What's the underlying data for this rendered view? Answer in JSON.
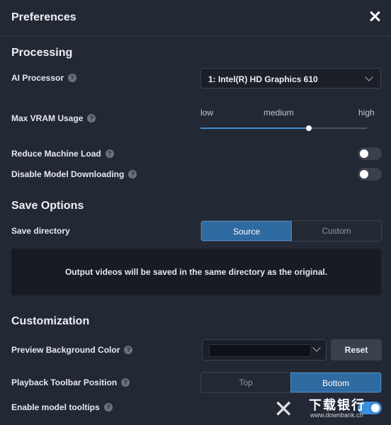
{
  "window": {
    "title": "Preferences"
  },
  "processing": {
    "heading": "Processing",
    "ai_processor": {
      "label": "AI Processor",
      "value": "1: Intel(R) HD Graphics 610"
    },
    "max_vram": {
      "label": "Max VRAM Usage",
      "low": "low",
      "medium": "medium",
      "high": "high",
      "level": 0.65
    },
    "reduce_machine_load": {
      "label": "Reduce Machine Load",
      "enabled": false
    },
    "disable_model_downloading": {
      "label": "Disable Model Downloading",
      "enabled": false
    }
  },
  "save_options": {
    "heading": "Save Options",
    "save_directory": {
      "label": "Save directory",
      "options": [
        "Source",
        "Custom"
      ],
      "selected": "Source"
    },
    "info": "Output videos will be saved in the same directory as the original."
  },
  "customization": {
    "heading": "Customization",
    "preview_bg_color": {
      "label": "Preview Background Color",
      "reset_label": "Reset",
      "color": "#0d1117"
    },
    "playback_toolbar_position": {
      "label": "Playback Toolbar Position",
      "options": [
        "Top",
        "Bottom"
      ],
      "selected": "Bottom"
    },
    "enable_model_tooltips": {
      "label": "Enable model tooltips",
      "enabled": true
    }
  },
  "watermark": {
    "text": "下载银行",
    "url": "www.downbank.cn"
  },
  "icons": {
    "help": "question-circle-icon",
    "close": "close-icon",
    "chevron": "chevron-down-icon"
  },
  "colors": {
    "accent": "#3d8ed8",
    "background": "#222834",
    "segment_active": "#2f6aa0"
  }
}
